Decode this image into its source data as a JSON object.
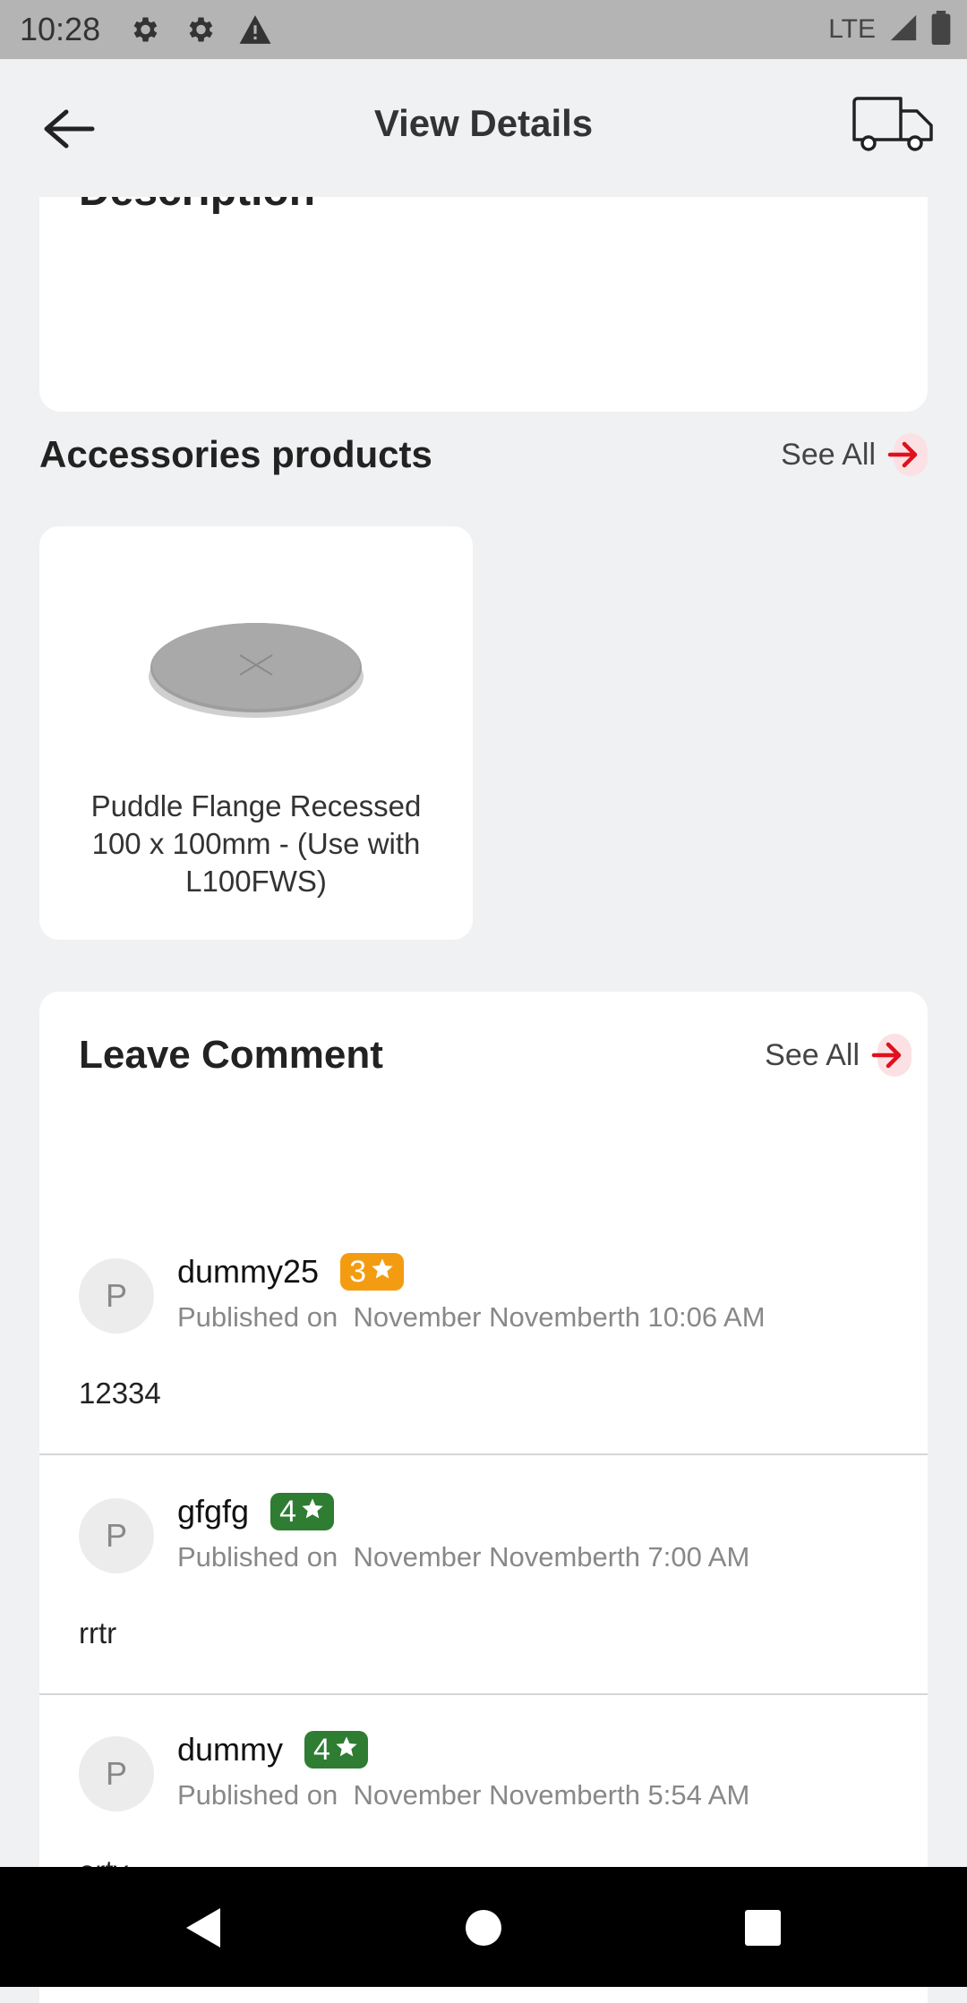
{
  "status_bar": {
    "time": "10:28",
    "network": "LTE",
    "icons": [
      "gear-icon",
      "gear-icon",
      "warning-icon",
      "signal-icon",
      "battery-icon"
    ]
  },
  "app_bar": {
    "title": "View Details",
    "back_icon": "arrow-left-icon",
    "truck_icon": "truck-icon"
  },
  "description": {
    "title": "Description"
  },
  "accessories": {
    "title": "Accessories products",
    "see_all": "See All",
    "products": [
      {
        "name": "Puddle Flange Recessed 100 x 100mm - (Use with L100FWS)"
      }
    ]
  },
  "comments": {
    "title": "Leave Comment",
    "see_all": "See All",
    "items": [
      {
        "avatar": "P",
        "name": "dummy25",
        "rating": "3",
        "badge_color": "#f39c12",
        "published_label": "Published on",
        "date": "November Novemberth 10:06 AM",
        "text": "12334"
      },
      {
        "avatar": "P",
        "name": "gfgfg",
        "rating": "4",
        "badge_color": "#2e7d32",
        "published_label": "Published on",
        "date": "November Novemberth 7:00 AM",
        "text": "rrtr"
      },
      {
        "avatar": "P",
        "name": "dummy",
        "rating": "4",
        "badge_color": "#2e7d32",
        "published_label": "Published on",
        "date": "November Novemberth 5:54 AM",
        "text": "erty"
      }
    ]
  },
  "colors": {
    "accent": "#e0101e",
    "background": "#f0f1f3"
  }
}
